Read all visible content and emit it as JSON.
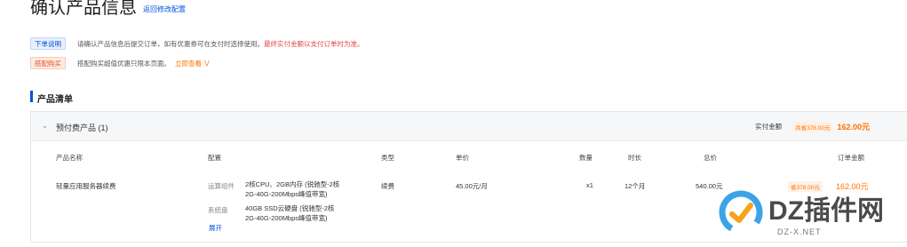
{
  "header": {
    "title": "确认产品信息",
    "back_link": "返回修改配置"
  },
  "notices": [
    {
      "tag": "下单说明",
      "text": "请确认产品信息后提交订单，如有优惠券可在支付时选择使用。",
      "highlight": "最终实付金额以支付订单时为准。"
    },
    {
      "tag": "搭配购买",
      "text": "搭配购买超值优惠只限本页面。",
      "link": "立即查看"
    }
  ],
  "section": {
    "title": "产品清单"
  },
  "group": {
    "title": "预付费产品 (1)",
    "paid_label": "实付金额",
    "saved": "共省378.00元",
    "paid_amount": "162.00元"
  },
  "table": {
    "headers": [
      "产品名称",
      "配置",
      "类型",
      "单价",
      "数量",
      "时长",
      "总价",
      "订单金额"
    ],
    "row": {
      "name": "轻量应用服务器续费",
      "config": [
        {
          "label": "运算组件",
          "line1": "2核CPU、2GB内存 (锐驰型-2核",
          "line2": "2G-40G-200Mbps峰值带宽)"
        },
        {
          "label": "系统盘",
          "line1": "40GB SSD云硬盘 (锐驰型-2核",
          "line2": "2G-40G-200Mbps峰值带宽)"
        }
      ],
      "expand": "展开",
      "type": "续费",
      "unit_price": "45.00元/月",
      "quantity": "x1",
      "duration": "12个月",
      "total": "540.00元",
      "saved": "省378.00元",
      "order_amount": "162.00元"
    }
  },
  "watermark": {
    "title": "DZ插件网",
    "url": "DZ-X.NET"
  },
  "colors": {
    "accent_blue": "#0052d9",
    "orange": "#ff7200",
    "red": "#e54545"
  }
}
